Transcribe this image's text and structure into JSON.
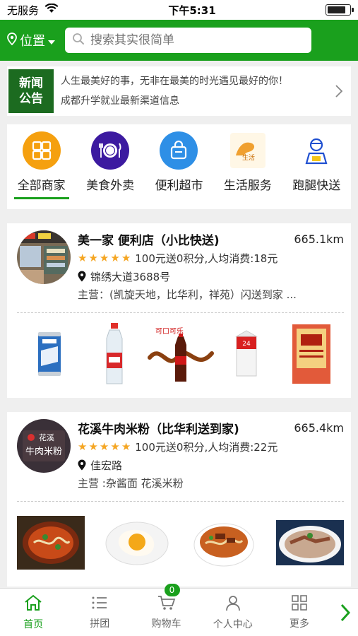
{
  "status_bar": {
    "carrier": "无服务",
    "time": "下午5:31",
    "battery_level": 0.85
  },
  "header": {
    "location_label": "位置",
    "search_placeholder": "搜索其实很简单"
  },
  "news": {
    "tag_line1": "新闻",
    "tag_line2": "公告",
    "items": [
      "人生最美好的事，无非在最美的时光遇见最好的你！",
      "成都升学就业最新渠道信息"
    ]
  },
  "categories": [
    {
      "label": "全部商家",
      "icon": "grid-icon",
      "color": "#f5a00f"
    },
    {
      "label": "美食外卖",
      "icon": "plate-icon",
      "color": "#3c1aa0"
    },
    {
      "label": "便利超市",
      "icon": "bag-icon",
      "color": "#2e8fe6"
    },
    {
      "label": "生活服务",
      "icon": "life-logo-icon",
      "color": "#f0a030"
    },
    {
      "label": "跑腿快送",
      "icon": "courier-icon",
      "color": "#1f4fd0"
    }
  ],
  "shops": [
    {
      "name": "美一家 便利店（小比快送)",
      "distance": "665.1km",
      "rating": 5,
      "promo": "100元送0积分,人均消费:18元",
      "address": "锦绣大道3688号",
      "main": "主营：(凯旋天地，比华利，祥苑）闪送到家 ...",
      "products": [
        "beer-can",
        "water-bottle",
        "cola",
        "milk-carton",
        "cigarette-pack"
      ]
    },
    {
      "name": "花溪牛肉米粉（比华利送到家)",
      "distance": "665.4km",
      "rating": 5,
      "promo": "100元送0积分,人均消费:22元",
      "address": "佳宏路",
      "main": "主营 :杂酱面 花溪米粉",
      "avatar_text_top": "花溪",
      "avatar_text_bottom": "牛肉米粉",
      "products": [
        "rice-noodle-bowl",
        "fried-egg",
        "beef-noodle",
        "beef-slices"
      ]
    }
  ],
  "tab_bar": {
    "tabs": [
      {
        "label": "首页",
        "icon": "home-icon"
      },
      {
        "label": "拼团",
        "icon": "list-icon"
      },
      {
        "label": "购物车",
        "icon": "cart-icon"
      },
      {
        "label": "个人中心",
        "icon": "person-icon"
      },
      {
        "label": "更多",
        "icon": "more-grid-icon"
      }
    ],
    "cart_count": "0",
    "active_color": "#1aa01d"
  }
}
